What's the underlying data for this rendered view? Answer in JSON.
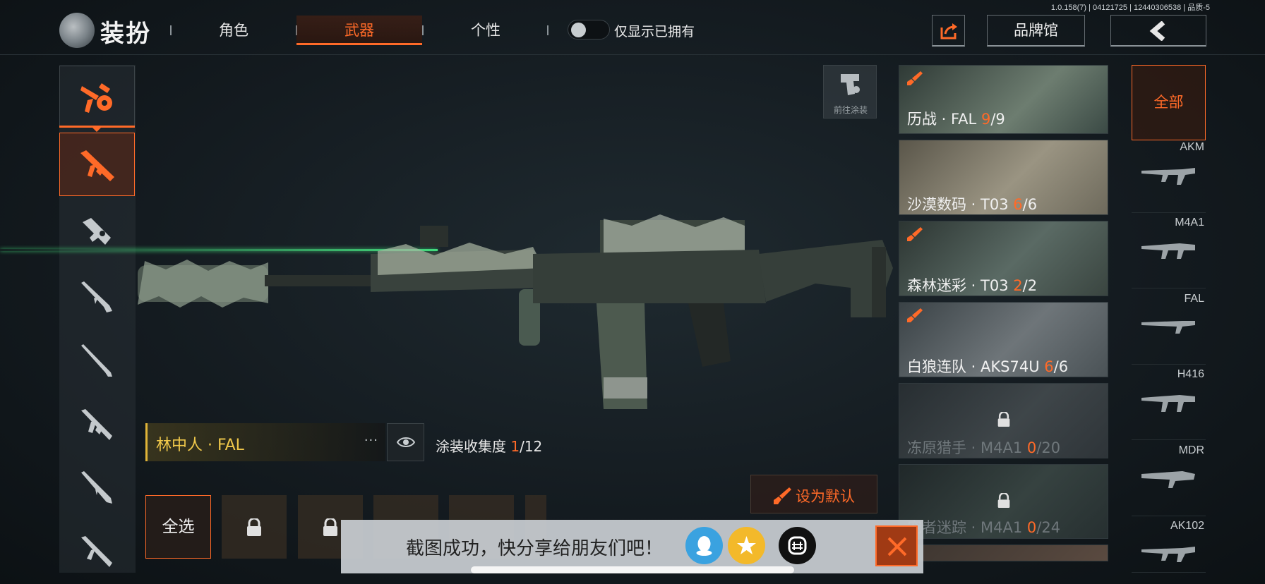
{
  "header": {
    "version_text": "1.0.158(7) | 04121725 | 12440306538 | 品质-5",
    "title": "装扮",
    "tabs": [
      {
        "label": "角色",
        "active": false
      },
      {
        "label": "武器",
        "active": true
      },
      {
        "label": "个性",
        "active": false
      }
    ],
    "toggle_label": "仅显示已拥有",
    "toggle_on": false,
    "brand_button": "品牌馆",
    "share_icon": "share-export-icon",
    "back_icon": "chevron-left-icon"
  },
  "categories": [
    {
      "icon": "all-weapons-icon",
      "selected": false
    },
    {
      "icon": "assault-rifle-icon",
      "selected": true
    },
    {
      "icon": "smg-icon",
      "selected": false
    },
    {
      "icon": "shotgun-icon",
      "selected": false
    },
    {
      "icon": "sniper-rifle-icon",
      "selected": false
    },
    {
      "icon": "lmg-icon",
      "selected": false
    },
    {
      "icon": "marksman-rifle-icon",
      "selected": false
    },
    {
      "icon": "rifle-icon",
      "selected": false
    }
  ],
  "viewer": {
    "goto_paint_label": "前往涂装",
    "skin_name": "林中人 · FAL",
    "more_icon": "···",
    "collection_label": "涂装收集度",
    "collection_have": "1",
    "collection_total": "/12",
    "set_default_label": "设为默认",
    "select_all_label": "全选"
  },
  "skins": [
    {
      "name": "历战 · FAL",
      "have": "9",
      "total": "/9",
      "locked": false,
      "brush": true,
      "colors": [
        "#3b4a45",
        "#6d7d70"
      ]
    },
    {
      "name": "沙漠数码 · T03",
      "have": "6",
      "total": "/6",
      "locked": false,
      "brush": false,
      "colors": [
        "#6e6a5c",
        "#9a9482"
      ]
    },
    {
      "name": "森林迷彩 · T03",
      "have": "2",
      "total": "/2",
      "locked": false,
      "brush": true,
      "colors": [
        "#3a4540",
        "#5a6a64"
      ]
    },
    {
      "name": "白狼连队 · AKS74U",
      "have": "6",
      "total": "/6",
      "locked": false,
      "brush": true,
      "colors": [
        "#4a5256",
        "#6e7579"
      ]
    },
    {
      "name": "冻原猎手 · M4A1",
      "have": "0",
      "total": "/20",
      "locked": true,
      "brush": false,
      "colors": [
        "#3a4044",
        "#51585b"
      ]
    },
    {
      "name": "宠者迷踪 · M4A1",
      "have": "0",
      "total": "/24",
      "locked": true,
      "brush": false,
      "colors": [
        "#2e3838",
        "#42504c"
      ]
    },
    {
      "name": "",
      "have": "",
      "total": "",
      "locked": false,
      "brush": false,
      "colors": [
        "#3c3530",
        "#5a4a40"
      ]
    }
  ],
  "filters": {
    "all_label": "全部",
    "weapons": [
      "AKM",
      "M4A1",
      "FAL",
      "H416",
      "MDR",
      "AK102"
    ]
  },
  "toast": {
    "text": "截图成功，快分享给朋友们吧！",
    "share_targets": [
      "qq-icon",
      "qzone-star-icon",
      "tiktok-style-icon"
    ],
    "close_icon": "close-x-icon"
  }
}
